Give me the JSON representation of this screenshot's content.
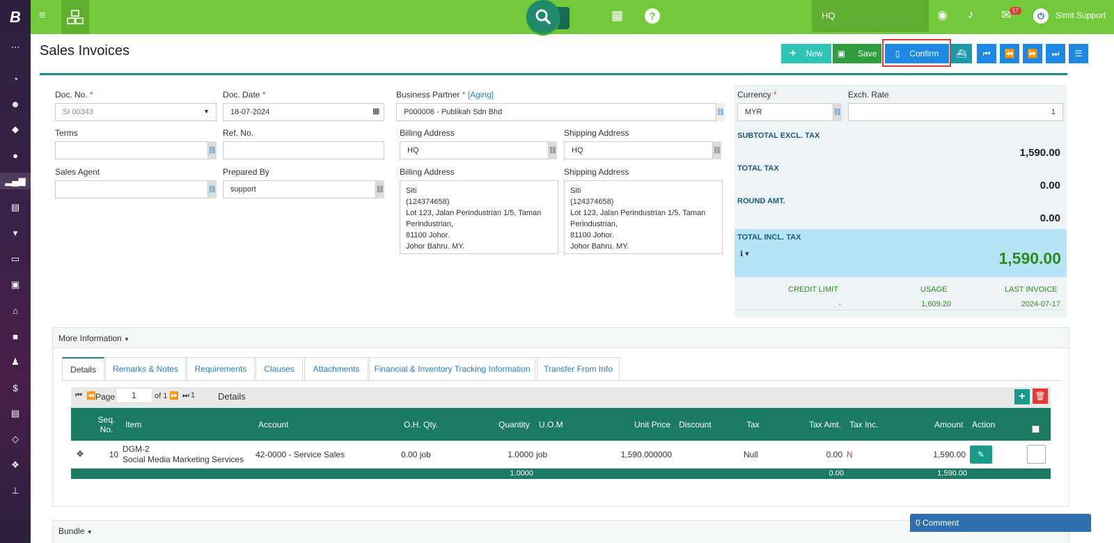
{
  "topbar": {
    "location": "HQ",
    "notification_count": "17",
    "user_name": "Simit Support"
  },
  "page": {
    "title": "Sales Invoices"
  },
  "toolbar": {
    "new_label": "New",
    "save_label": "Save",
    "confirm_label": "Confirm"
  },
  "form": {
    "doc_no_label": "Doc. No.",
    "doc_no_value": "SI 00343",
    "doc_date_label": "Doc. Date",
    "doc_date_value": "18-07-2024",
    "bp_label": "Business Partner",
    "bp_aging": "[Aging]",
    "bp_value": "P000006 - Publikah Sdn Bhd",
    "terms_label": "Terms",
    "terms_value": "",
    "ref_label": "Ref. No.",
    "ref_value": "",
    "billing_label": "Billing Address",
    "billing_value": "HQ",
    "shipping_label": "Shipping Address",
    "shipping_value": "HQ",
    "agent_label": "Sales Agent",
    "agent_value": "",
    "prepared_label": "Prepared By",
    "prepared_value": "support",
    "billing_addr_label": "Billing Address",
    "shipping_addr_label": "Shipping Address",
    "billing_lines": [
      "Siti",
      "(124374658)",
      "Lot 123, Jalan Perindustrian 1/5, Taman",
      "Perindustrian,",
      "81100 Johor.",
      "Johor Bahru. MY."
    ],
    "shipping_lines": [
      "Siti",
      "(124374658)",
      "Lot 123, Jalan Perindustrian 1/5, Taman",
      "Perindustrian,",
      "81100 Johor.",
      "Johor Bahru. MY."
    ]
  },
  "summary": {
    "currency_label": "Currency",
    "currency_value": "MYR",
    "exch_label": "Exch. Rate",
    "exch_value": "1",
    "subtotal_label": "SUBTOTAL EXCL. TAX",
    "subtotal_value": "1,590.00",
    "tax_label": "TOTAL TAX",
    "tax_value": "0.00",
    "round_label": "ROUND AMT.",
    "round_value": "0.00",
    "total_label": "TOTAL INCL. TAX",
    "total_value": "1,590.00",
    "credit_limit_label": "CREDIT LIMIT",
    "credit_limit_value": "-",
    "usage_label": "USAGE",
    "usage_value": "1,609.20",
    "last_invoice_label": "LAST INVOICE",
    "last_invoice_value": "2024-07-17"
  },
  "more_info": {
    "title": "More Information"
  },
  "tabs": [
    "Details",
    "Remarks & Notes",
    "Requirements",
    "Clauses",
    "Attachments",
    "Financial & Inventory Tracking Information",
    "Transfer From Info"
  ],
  "pager": {
    "page_label": "Page",
    "page_value": "1",
    "of_label": "of 1",
    "total": "1",
    "section": "Details"
  },
  "grid": {
    "headers": [
      "Seq.\nNo.",
      "Item",
      "Account",
      "O.H. Qty.",
      "Quantity",
      "U.O.M",
      "Unit Price",
      "Discount",
      "Tax",
      "Tax Amt.",
      "Tax Inc.",
      "Amount",
      "Action"
    ],
    "row": {
      "seq": "10",
      "item_code": "DGM-2",
      "item_name": "Social Media Marketing Services",
      "account": "42-0000 - Service Sales",
      "oh_qty": "0.00 job",
      "quantity": "1.0000",
      "uom": "job",
      "unit_price": "1,590.000000",
      "discount": "",
      "tax": "Null",
      "tax_amt": "0.00",
      "tax_inc": "N",
      "amount": "1,590.00"
    },
    "footer": {
      "quantity": "1.0000",
      "tax_amt": "0.00",
      "amount": "1,590.00"
    }
  },
  "bundle": {
    "title": "Bundle"
  },
  "comments": {
    "label": "0 Comment"
  },
  "colors": {
    "topbar": "#72c93a",
    "primary": "#1e88e5",
    "grid_header": "#1a7a62",
    "total_green": "#2e8b1f",
    "highlight": "#e53935"
  }
}
